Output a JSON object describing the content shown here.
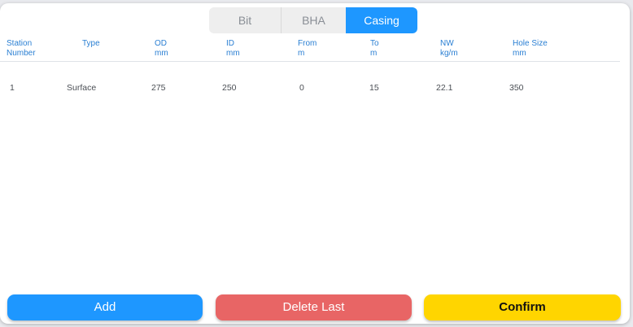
{
  "tabs": [
    {
      "label": "Bit",
      "active": false
    },
    {
      "label": "BHA",
      "active": false
    },
    {
      "label": "Casing",
      "active": true
    }
  ],
  "table": {
    "columns": [
      {
        "title": "Station",
        "unit": "Number"
      },
      {
        "title": "Type",
        "unit": ""
      },
      {
        "title": "OD",
        "unit": "mm"
      },
      {
        "title": "ID",
        "unit": "mm"
      },
      {
        "title": "From",
        "unit": "m"
      },
      {
        "title": "To",
        "unit": "m"
      },
      {
        "title": "NW",
        "unit": "kg/m"
      },
      {
        "title": "Hole Size",
        "unit": "mm"
      }
    ],
    "rows": [
      [
        "1",
        "Surface",
        "275",
        "250",
        "0",
        "15",
        "22.1",
        "350"
      ]
    ]
  },
  "buttons": {
    "add": "Add",
    "delete_last": "Delete Last",
    "confirm": "Confirm"
  },
  "colors": {
    "accent_blue": "#1e97ff",
    "delete_red": "#e86565",
    "confirm_yellow": "#ffd500",
    "header_text": "#2a7fd3"
  }
}
